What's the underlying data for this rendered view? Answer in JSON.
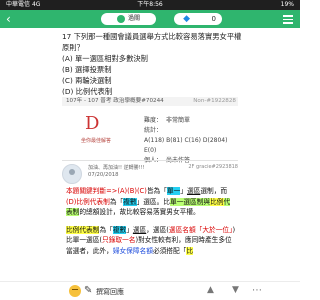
{
  "status_bar": {
    "carrier": "中華電信",
    "network": "4G",
    "time": "下午8:56",
    "battery": "19%"
  },
  "header": {
    "pass_label": "過關",
    "diamond_count": "0"
  },
  "question": {
    "text": "17 下列那一種國會議員選舉方式比較容易落實男女平權原則？",
    "options": [
      "(A) 單一選區相對多數決制",
      "(B) 選擇投票制",
      "(C) 兩輪決選制",
      "(D) 比例代表制"
    ],
    "meta": "107年 - 107 普考 政治學概要#70244",
    "id": "Non-#1922828"
  },
  "answer": {
    "letter": "D",
    "note": "坐你最佳解答",
    "stats": [
      {
        "key": "難度：",
        "value": "非常簡單"
      },
      {
        "key": "統計：",
        "value": "A(118) B(81) C(16) D(2804) E(0)"
      },
      {
        "key": "個人：",
        "value": "尚未作答"
      }
    ]
  },
  "comment": {
    "user": "加油、再加油!! 逆轉勝!!!",
    "date": "07/20/2018",
    "floor": "2F  gracie#2923818",
    "heading": "本題關鍵判斷=>",
    "actions": {
      "reply": "撰寫回應"
    }
  },
  "colors": {
    "brand": "#2fb56e",
    "answer_red": "#cc3333"
  }
}
